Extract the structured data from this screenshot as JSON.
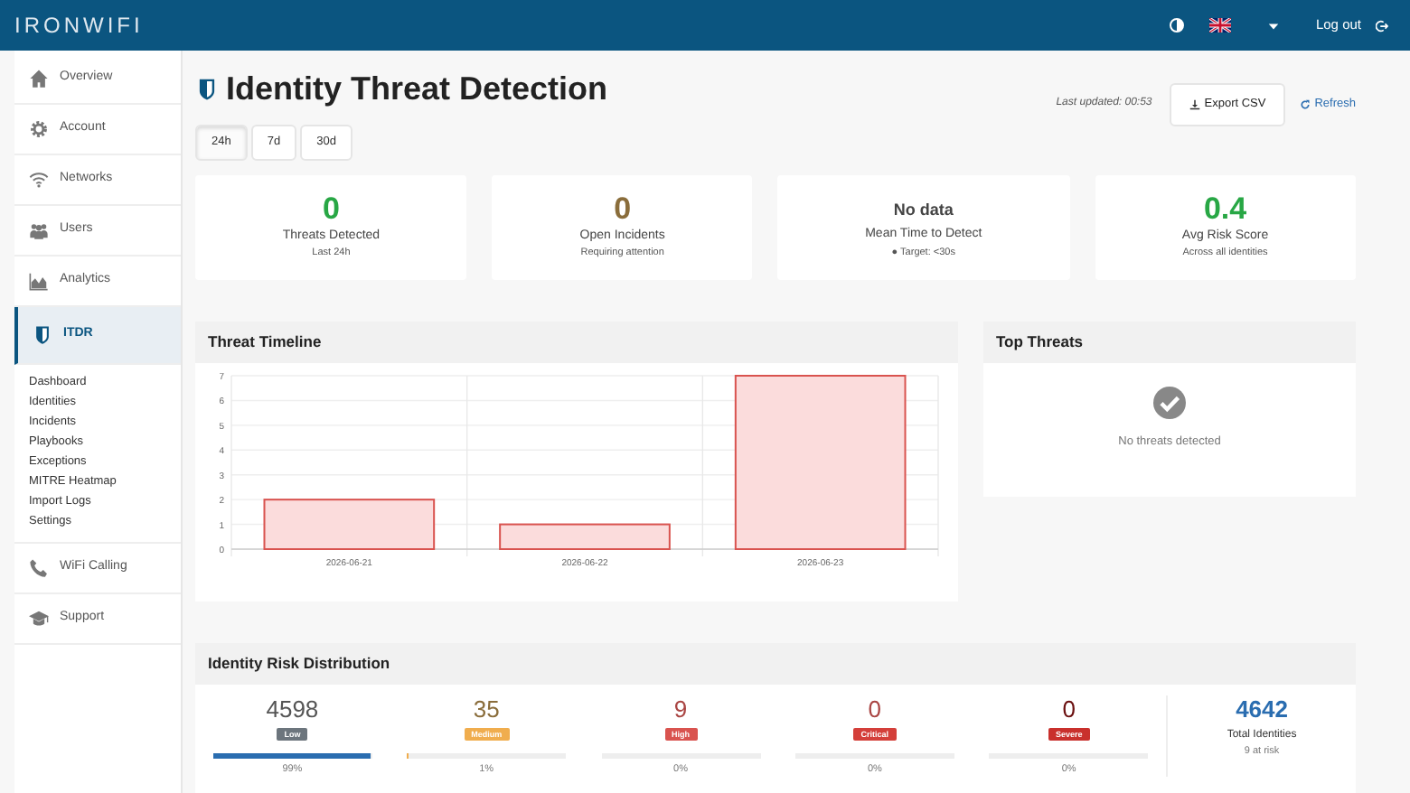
{
  "navbar": {
    "logo": "IRONWIFI",
    "logout": "Log out"
  },
  "sidebar": {
    "items": [
      {
        "label": "Overview",
        "selected": false
      },
      {
        "label": "Account",
        "selected": false
      },
      {
        "label": "Networks",
        "selected": false
      },
      {
        "label": "Users",
        "selected": false
      },
      {
        "label": "Analytics",
        "selected": false
      },
      {
        "label": "ITDR",
        "selected": true,
        "children": [
          {
            "label": "Dashboard"
          },
          {
            "label": "Identities"
          },
          {
            "label": "Incidents"
          },
          {
            "label": "Playbooks"
          },
          {
            "label": "Exceptions"
          },
          {
            "label": "MITRE Heatmap"
          },
          {
            "label": "Import Logs"
          },
          {
            "label": "Settings"
          }
        ]
      },
      {
        "label": "WiFi Calling",
        "selected": false
      },
      {
        "label": "Support",
        "selected": false
      }
    ]
  },
  "page": {
    "title": "Identity Threat Detection",
    "last_updated": "Last updated: 00:53",
    "export": "Export CSV",
    "refresh": "Refresh"
  },
  "range_tabs": [
    {
      "label": "24h",
      "selected": true
    },
    {
      "label": "7d",
      "selected": false
    },
    {
      "label": "30d",
      "selected": false
    }
  ],
  "stats": [
    {
      "value": "0",
      "label": "Threats Detected",
      "sub": "Last 24h",
      "color": "#28a745"
    },
    {
      "value": "0",
      "label": "Open Incidents",
      "sub": "Requiring attention",
      "color": "#8a6d3b"
    },
    {
      "value": "No data",
      "label": "Mean Time to Detect",
      "sub": "● Target: <30s",
      "color": "#444444"
    },
    {
      "value": "0.4",
      "label": "Avg Risk Score",
      "sub": "Across all identities",
      "color": "#28a745"
    }
  ],
  "timeline": {
    "title": "Threat Timeline",
    "chart_data": {
      "type": "bar",
      "categories": [
        "2026-06-21",
        "2026-06-22",
        "2026-06-23"
      ],
      "values": [
        2,
        1,
        7
      ],
      "ylim": [
        0,
        7
      ],
      "yticks": [
        0,
        1,
        2,
        3,
        4,
        5,
        6,
        7
      ],
      "grid": true
    }
  },
  "top_threats": {
    "title": "Top Threats",
    "empty": "No threats detected"
  },
  "risk": {
    "title": "Identity Risk Distribution",
    "levels": [
      {
        "value": "4598",
        "badge": "Low",
        "level": 0.99,
        "percent": "99%",
        "color": "#6c757d"
      },
      {
        "value": "35",
        "badge": "Medium",
        "level": 0.01,
        "percent": "1%",
        "color": "#f0ad4e"
      },
      {
        "value": "9",
        "badge": "High",
        "level": 0,
        "percent": "0%",
        "color": "#d9534f"
      },
      {
        "value": "0",
        "badge": "Critical",
        "level": 0,
        "percent": "0%",
        "color": "#d43f3a"
      },
      {
        "value": "0",
        "badge": "Severe",
        "level": 0,
        "percent": "0%",
        "color": "#c9302c"
      }
    ],
    "total": {
      "value": "4642",
      "label": "Total Identities",
      "sub": "9 at risk"
    }
  }
}
